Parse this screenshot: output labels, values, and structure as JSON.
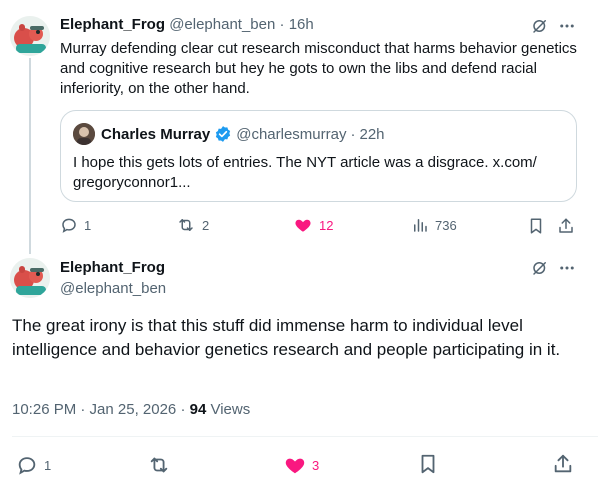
{
  "reply_tweet": {
    "display_name": "Elephant_Frog",
    "handle": "@elephant_ben",
    "separator": "·",
    "time": "16h",
    "text": "Murray defending clear cut research misconduct that harms behavior genetics and cognitive research but hey he gots to own the libs and defend racial inferiority, on the other hand.",
    "quote": {
      "display_name": "Charles Murray",
      "handle": "@charlesmurray",
      "separator": "·",
      "time": "22h",
      "text": "I hope this gets lots of entries. The NYT article was a disgrace. x.com/ gregoryconnor1..."
    },
    "actions": {
      "replies": "1",
      "reposts": "2",
      "likes": "12",
      "views": "736"
    }
  },
  "main_tweet": {
    "display_name": "Elephant_Frog",
    "handle": "@elephant_ben",
    "text": "The great irony is that this stuff did immense harm to individual level intelligence and behavior genetics research and people participating in it.",
    "timestamp": "10:26 PM · Jan 25, 2026 · ",
    "views_count": "94",
    "views_label": " Views",
    "actions": {
      "replies": "1",
      "likes": "3"
    }
  },
  "colors": {
    "text": "#0f1419",
    "muted": "#536471",
    "like": "#f91880",
    "verified": "#1d9bf0",
    "border": "#cfd9de"
  },
  "icons": [
    "grok-icon",
    "more-icon",
    "reply-icon",
    "repost-icon",
    "heart-filled-icon",
    "views-icon",
    "bookmark-icon",
    "share-icon",
    "verified-badge-icon"
  ]
}
